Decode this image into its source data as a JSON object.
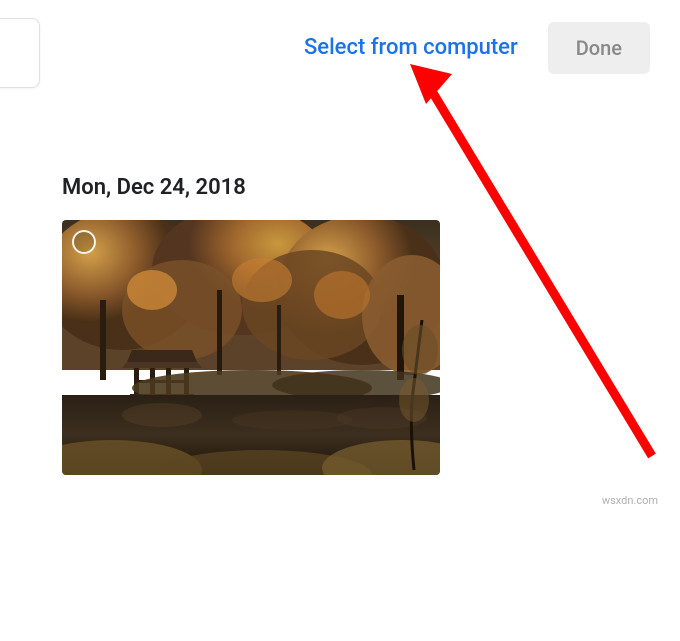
{
  "header": {
    "select_link_label": "Select from computer",
    "done_button_label": "Done"
  },
  "gallery": {
    "date_label": "Mon, Dec 24, 2018"
  },
  "watermark": "wsxdn.com"
}
